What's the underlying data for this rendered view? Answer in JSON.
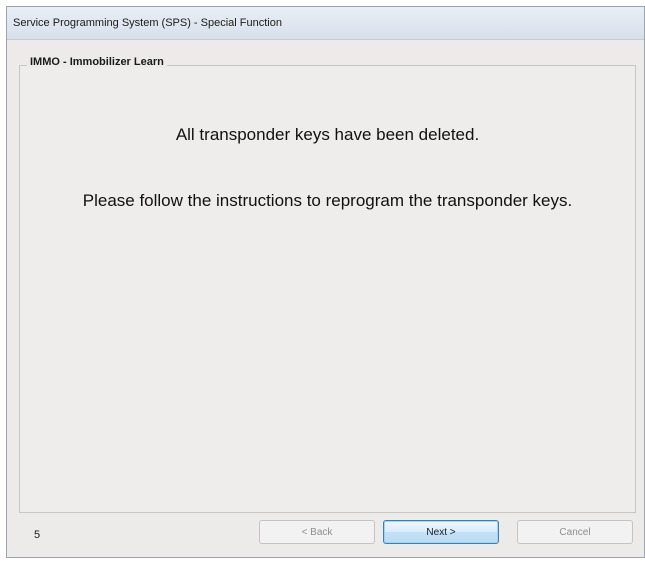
{
  "window": {
    "title": "Service Programming System (SPS) - Special Function"
  },
  "group": {
    "label": "IMMO - Immobilizer Learn"
  },
  "messages": {
    "line1": "All transponder keys have been deleted.",
    "line2": "Please follow the instructions to reprogram the transponder keys."
  },
  "footer": {
    "page_number": "5",
    "back_label": "< Back",
    "next_label": "Next >",
    "cancel_label": "Cancel",
    "back_enabled": false,
    "next_enabled": true,
    "cancel_enabled": false
  },
  "colors": {
    "window_background": "#ecebe9",
    "titlebar": "#dfe6ef",
    "next_button_accent": "#3c7fb1"
  }
}
